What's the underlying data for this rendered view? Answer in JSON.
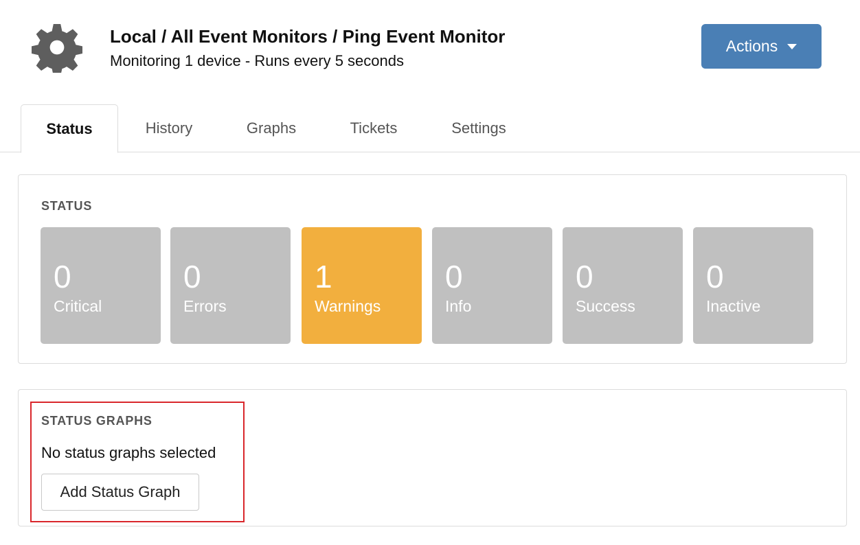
{
  "header": {
    "breadcrumb": "Local / All Event Monitors / Ping Event Monitor",
    "subtitle": "Monitoring 1 device - Runs every 5 seconds",
    "actions_label": "Actions"
  },
  "tabs": [
    {
      "label": "Status",
      "active": true
    },
    {
      "label": "History",
      "active": false
    },
    {
      "label": "Graphs",
      "active": false
    },
    {
      "label": "Tickets",
      "active": false
    },
    {
      "label": "Settings",
      "active": false
    }
  ],
  "status": {
    "section_label": "STATUS",
    "tiles": [
      {
        "count": "0",
        "label": "Critical",
        "color": "#c0c0c0"
      },
      {
        "count": "0",
        "label": "Errors",
        "color": "#c0c0c0"
      },
      {
        "count": "1",
        "label": "Warnings",
        "color": "#f2af3e"
      },
      {
        "count": "0",
        "label": "Info",
        "color": "#c0c0c0"
      },
      {
        "count": "0",
        "label": "Success",
        "color": "#c0c0c0"
      },
      {
        "count": "0",
        "label": "Inactive",
        "color": "#c0c0c0"
      }
    ]
  },
  "status_graphs": {
    "section_label": "STATUS GRAPHS",
    "empty_text": "No status graphs selected",
    "add_button_label": "Add Status Graph"
  },
  "colors": {
    "primary": "#4a7fb5",
    "warning": "#f2af3e",
    "inactive_tile": "#c0c0c0",
    "highlight": "#d9262b"
  },
  "icons": {
    "header_icon": "gear-icon",
    "actions_caret": "caret-down-icon"
  }
}
